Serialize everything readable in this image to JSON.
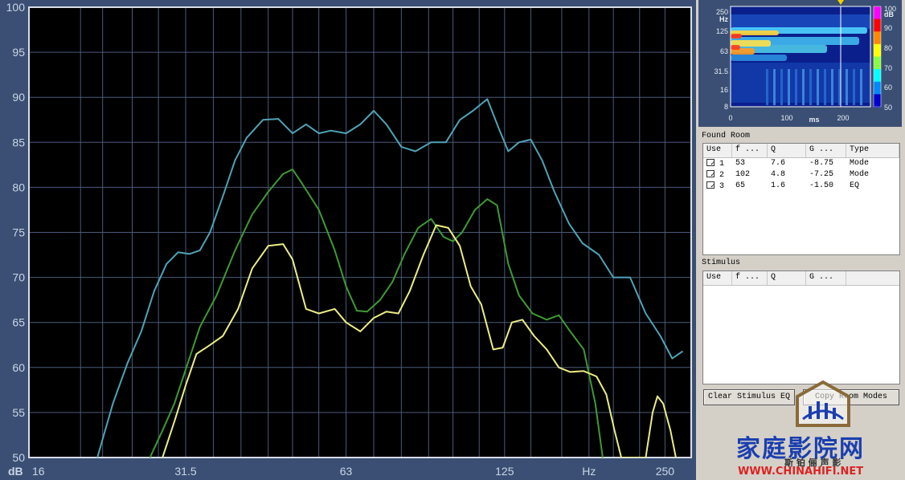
{
  "response_plot": {
    "y_unit": "dB",
    "x_unit": "Hz",
    "y_ticks": [
      "100",
      "95",
      "90",
      "85",
      "80",
      "75",
      "70",
      "65",
      "60",
      "55",
      "50"
    ],
    "x_ticks": [
      "16",
      "31.5",
      "63",
      "125",
      "250"
    ],
    "colors": {
      "blue": "#4fa3b8",
      "green": "#3f9a34",
      "yellow": "#ecec86",
      "grid": "#4a5a7a",
      "bg": "#000000"
    }
  },
  "chart_data": {
    "type": "line",
    "xscale": "log",
    "xlim": [
      16,
      280
    ],
    "ylim": [
      50,
      100
    ],
    "xlabel": "Hz",
    "ylabel": "dB",
    "series": [
      {
        "color": "#4fa3b8",
        "points": [
          [
            21.5,
            50
          ],
          [
            23,
            56
          ],
          [
            24.5,
            60.5
          ],
          [
            26,
            64
          ],
          [
            27.5,
            68.5
          ],
          [
            29,
            71.5
          ],
          [
            30.5,
            72.8
          ],
          [
            32,
            72.6
          ],
          [
            33.5,
            73
          ],
          [
            35,
            75
          ],
          [
            37,
            79
          ],
          [
            39,
            83
          ],
          [
            41,
            85.5
          ],
          [
            44,
            87.5
          ],
          [
            47,
            87.6
          ],
          [
            50,
            86
          ],
          [
            53,
            87
          ],
          [
            56,
            86
          ],
          [
            59,
            86.3
          ],
          [
            63,
            86
          ],
          [
            67,
            87
          ],
          [
            71,
            88.5
          ],
          [
            75,
            87
          ],
          [
            80,
            84.5
          ],
          [
            85,
            84
          ],
          [
            91,
            85
          ],
          [
            97,
            85
          ],
          [
            103,
            87.5
          ],
          [
            109,
            88.5
          ],
          [
            116,
            89.8
          ],
          [
            122,
            86.5
          ],
          [
            127,
            84
          ],
          [
            133,
            85
          ],
          [
            140,
            85.3
          ],
          [
            147,
            83
          ],
          [
            155,
            79.5
          ],
          [
            165,
            76
          ],
          [
            175,
            73.8
          ],
          [
            188,
            72.5
          ],
          [
            200,
            70
          ],
          [
            215,
            70
          ],
          [
            230,
            66
          ],
          [
            245,
            63.5
          ],
          [
            258,
            61
          ],
          [
            270,
            61.8
          ]
        ]
      },
      {
        "color": "#3f9a34",
        "points": [
          [
            27,
            50
          ],
          [
            28.5,
            53
          ],
          [
            30,
            56
          ],
          [
            32,
            61
          ],
          [
            33.5,
            64.5
          ],
          [
            36,
            68
          ],
          [
            39,
            73
          ],
          [
            42,
            77
          ],
          [
            45,
            79.5
          ],
          [
            48,
            81.5
          ],
          [
            50,
            82
          ],
          [
            52,
            80.5
          ],
          [
            56,
            77.5
          ],
          [
            60,
            73
          ],
          [
            63,
            69
          ],
          [
            66,
            66.3
          ],
          [
            69,
            66.2
          ],
          [
            73,
            67.5
          ],
          [
            77,
            69.5
          ],
          [
            81,
            72.5
          ],
          [
            86,
            75.5
          ],
          [
            91,
            76.5
          ],
          [
            96,
            74.5
          ],
          [
            100,
            74
          ],
          [
            104,
            75
          ],
          [
            110,
            77.5
          ],
          [
            116,
            78.7
          ],
          [
            121,
            78
          ],
          [
            127,
            71.5
          ],
          [
            133,
            68
          ],
          [
            141,
            66
          ],
          [
            150,
            65.3
          ],
          [
            158,
            65.8
          ],
          [
            166,
            64
          ],
          [
            176,
            62
          ],
          [
            185,
            56
          ],
          [
            191,
            50
          ]
        ]
      },
      {
        "color": "#ecec86",
        "points": [
          [
            28.5,
            50
          ],
          [
            30,
            54
          ],
          [
            31.5,
            58
          ],
          [
            33,
            61.5
          ],
          [
            35,
            62.5
          ],
          [
            37,
            63.5
          ],
          [
            39.5,
            66.5
          ],
          [
            42,
            71
          ],
          [
            45,
            73.5
          ],
          [
            48,
            73.7
          ],
          [
            50,
            72
          ],
          [
            53,
            66.5
          ],
          [
            56,
            66
          ],
          [
            60,
            66.5
          ],
          [
            63,
            65
          ],
          [
            67,
            64
          ],
          [
            71,
            65.5
          ],
          [
            75,
            66.2
          ],
          [
            79,
            66
          ],
          [
            83,
            68.5
          ],
          [
            88,
            72.5
          ],
          [
            93,
            75.8
          ],
          [
            98,
            75.5
          ],
          [
            103,
            73.5
          ],
          [
            108,
            69
          ],
          [
            113,
            67
          ],
          [
            119,
            62
          ],
          [
            124,
            62.2
          ],
          [
            129,
            65
          ],
          [
            135,
            65.3
          ],
          [
            142,
            63.5
          ],
          [
            150,
            62
          ],
          [
            158,
            60
          ],
          [
            166,
            59.5
          ],
          [
            176,
            59.6
          ],
          [
            186,
            59
          ],
          [
            194,
            57
          ],
          [
            201,
            53
          ],
          [
            207,
            50
          ],
          [
            230,
            50
          ],
          [
            237,
            55
          ],
          [
            242,
            56.8
          ],
          [
            248,
            56
          ],
          [
            256,
            53
          ],
          [
            262,
            50
          ]
        ]
      }
    ]
  },
  "spectrogram": {
    "y_unit": "Hz",
    "y_ticks": [
      "250",
      "125",
      "63",
      "31.5",
      "16",
      "8"
    ],
    "x_ticks": [
      "0",
      "100",
      "200"
    ],
    "x_unit": "ms",
    "colorbar_unit": "dB",
    "colorbar_ticks": [
      "100",
      "90",
      "80",
      "70",
      "60",
      "50"
    ]
  },
  "found_room": {
    "title": "Found Room",
    "columns": [
      "Use",
      "f ...",
      "Q",
      "G ...",
      "Type"
    ],
    "rows": [
      {
        "use": "1",
        "f": "53",
        "q": "7.6",
        "g": "-8.75",
        "type": "Mode"
      },
      {
        "use": "2",
        "f": "102",
        "q": "4.8",
        "g": "-7.25",
        "type": "Mode"
      },
      {
        "use": "3",
        "f": "65",
        "q": "1.6",
        "g": "-1.50",
        "type": "EQ"
      }
    ]
  },
  "stimulus": {
    "title": "Stimulus",
    "columns": [
      "Use",
      "f ...",
      "Q",
      "G ..."
    ]
  },
  "buttons": {
    "clear": "Clear Stimulus EQ",
    "copy": "Copy Room Modes"
  },
  "watermark": {
    "title": "家庭影院网",
    "subtitle": "斯  铂  俪  声  影",
    "url": "WWW.CHINAHIFI.NET"
  }
}
